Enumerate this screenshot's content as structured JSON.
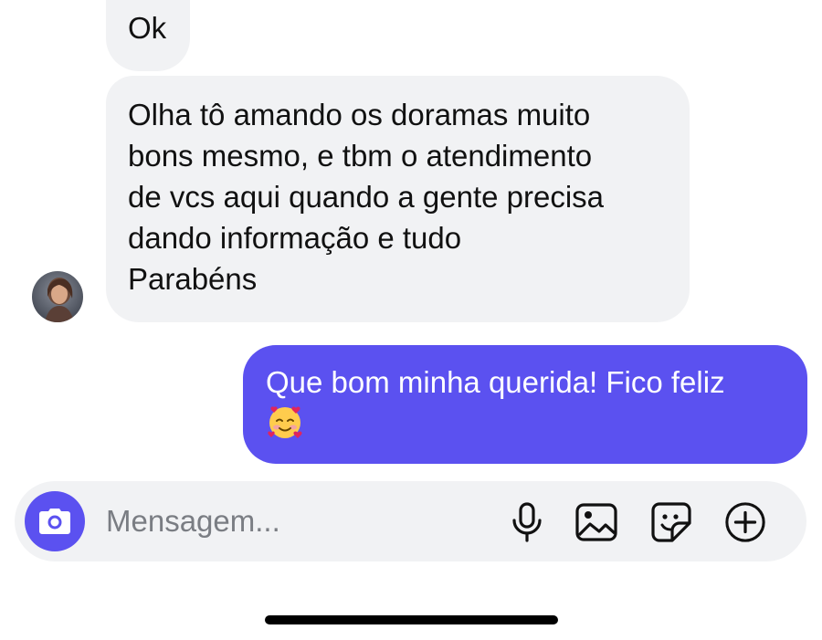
{
  "conversation": {
    "messages": [
      {
        "sender": "contact",
        "lines": [
          "Ok"
        ]
      },
      {
        "sender": "contact",
        "lines": [
          "Olha tô amando os doramas muito",
          "bons mesmo, e tbm o atendimento",
          "de vcs aqui quando a gente precisa",
          "dando informação e tudo",
          "Parabéns"
        ]
      },
      {
        "sender": "me",
        "lines": [
          "Que bom minha querida! Fico feliz"
        ],
        "emoji": "smiling-face-with-hearts"
      }
    ]
  },
  "composer": {
    "placeholder": "Mensagem...",
    "icons": [
      "camera-icon",
      "microphone-icon",
      "image-icon",
      "sticker-icon",
      "plus-circle-icon"
    ]
  },
  "colors": {
    "accent": "#5b51f0",
    "incoming_bubble": "#f1f2f4",
    "background": "#ffffff"
  }
}
